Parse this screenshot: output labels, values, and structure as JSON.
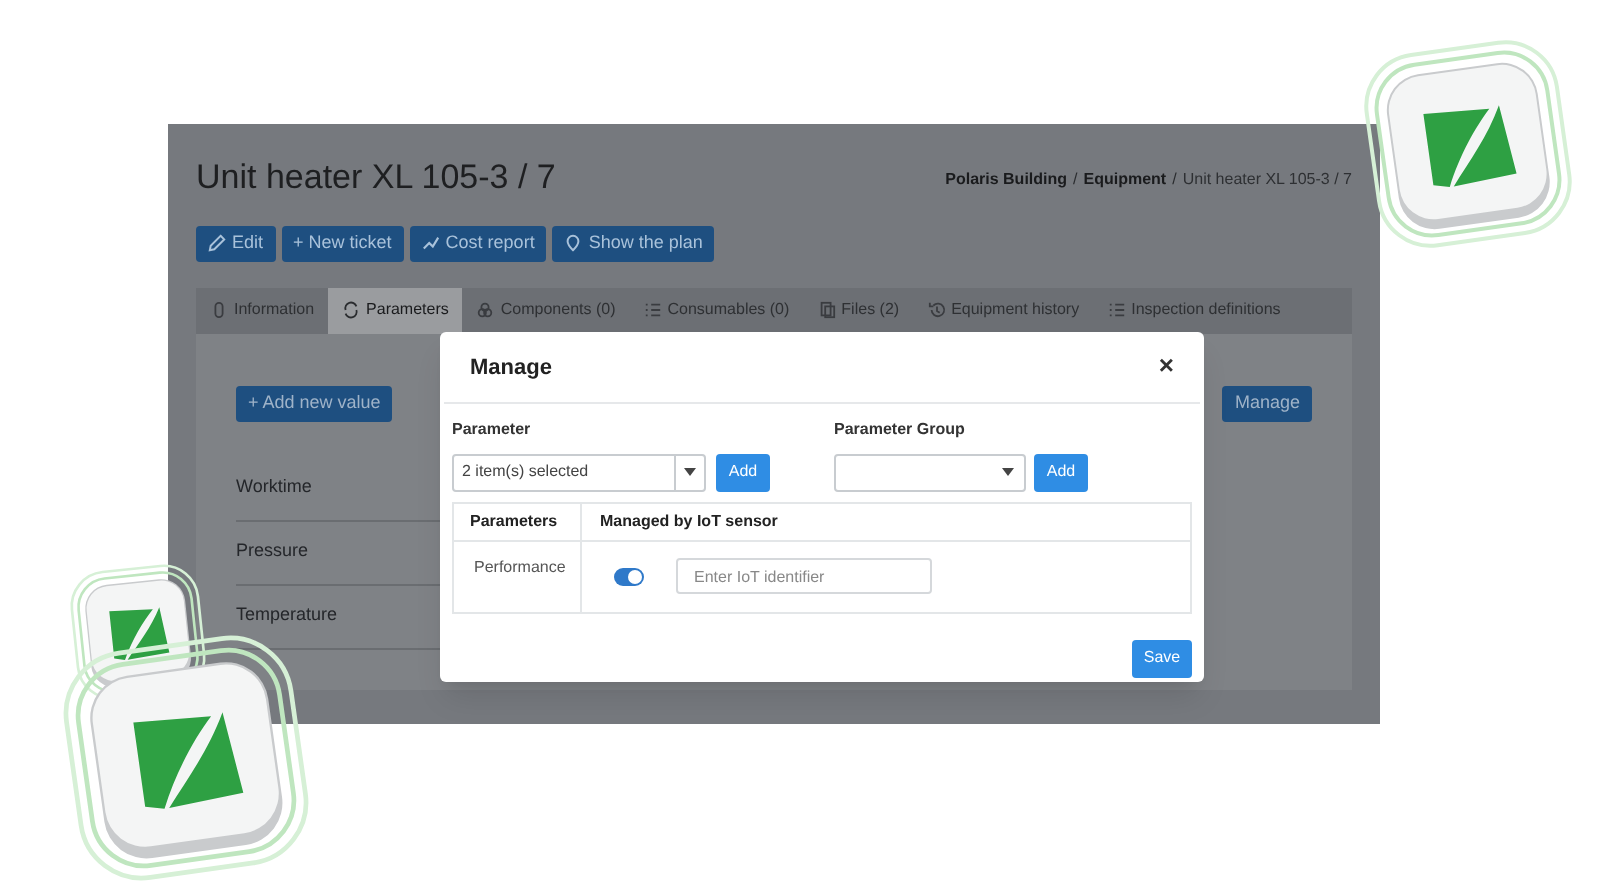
{
  "page": {
    "title": "Unit heater XL 105-3 / 7",
    "breadcrumb_separator": "/",
    "breadcrumb": [
      {
        "label": "Polaris Building",
        "current": false
      },
      {
        "label": "Equipment",
        "current": false
      },
      {
        "label": "Unit heater XL 105-3 / 7",
        "current": true
      }
    ],
    "actions": [
      "Edit",
      "+ New ticket",
      "Cost report",
      "Show the plan"
    ],
    "tabs": [
      {
        "label": "Information",
        "selected": false
      },
      {
        "label": "Parameters",
        "selected": true
      },
      {
        "label": "Components (0)",
        "selected": false
      },
      {
        "label": "Consumables (0)",
        "selected": false
      },
      {
        "label": "Files (2)",
        "selected": false
      },
      {
        "label": "Equipment history",
        "selected": false
      },
      {
        "label": "Inspection definitions",
        "selected": false
      }
    ],
    "add_button": "+ Add new value",
    "manage_button": "Manage",
    "parameters": [
      "Worktime",
      "Pressure",
      "Temperature"
    ]
  },
  "modal": {
    "title": "Manage",
    "close": "×",
    "parameter_label": "Parameter",
    "parameter_value": "2 item(s) selected",
    "parameter_add": "Add",
    "group_label": "Parameter Group",
    "group_add": "Add",
    "columns": [
      "Parameters",
      "Managed by IoT sensor"
    ],
    "rows": [
      {
        "name": "Performance",
        "on": true,
        "placeholder": "Enter IoT identifier"
      }
    ],
    "save": "Save"
  }
}
